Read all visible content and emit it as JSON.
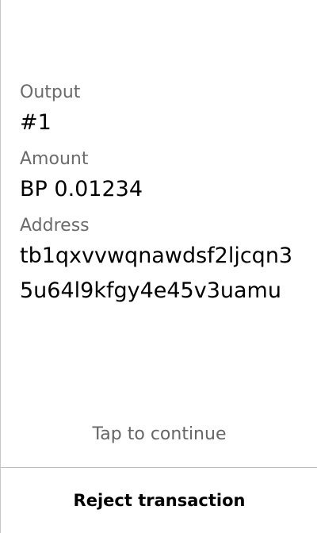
{
  "output": {
    "label": "Output",
    "value": "#1"
  },
  "amount": {
    "label": "Amount",
    "value": "BP 0.01234"
  },
  "address": {
    "label": "Address",
    "value": "tb1qxvvwqnawdsf2ljcqn35u64l9kfgy4e45v3uamu"
  },
  "hint": {
    "tap_to_continue": "Tap to continue"
  },
  "actions": {
    "reject_label": "Reject transaction"
  },
  "colors": {
    "background": "#ffffff",
    "label_text": "#6b6b6b",
    "value_text": "#000000",
    "divider": "#bdbdbd"
  }
}
